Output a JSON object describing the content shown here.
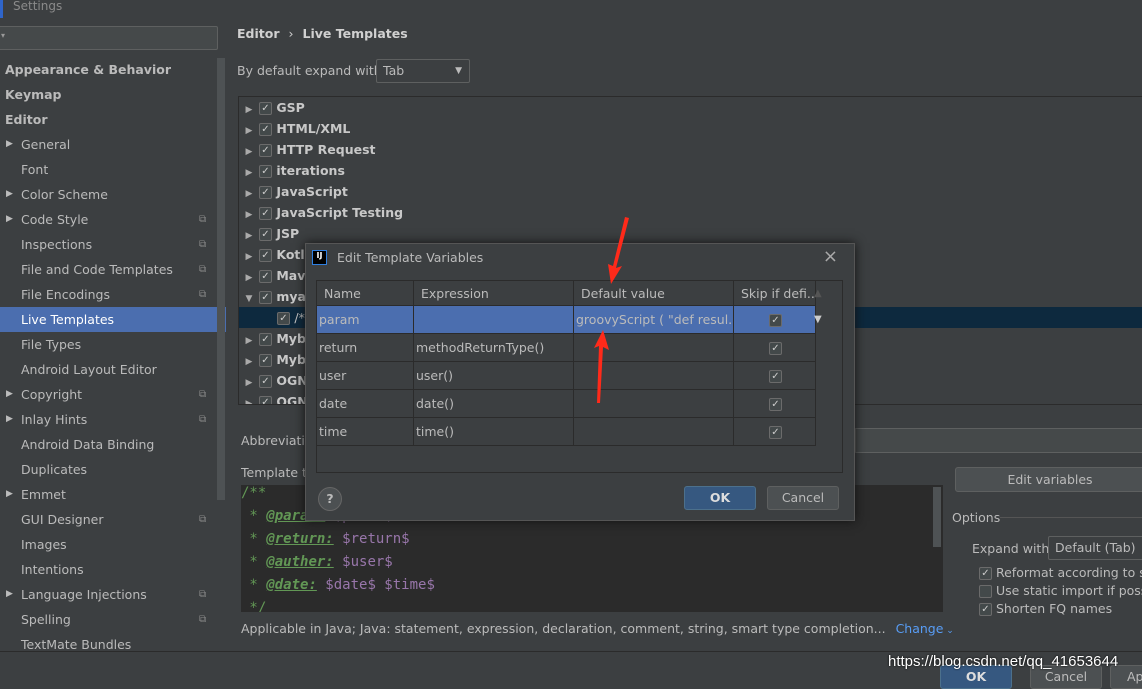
{
  "window": {
    "title": "Settings"
  },
  "sidebar": {
    "items": [
      {
        "label": "Appearance & Behavior",
        "level": 0
      },
      {
        "label": "Keymap",
        "level": 0
      },
      {
        "label": "Editor",
        "level": 0
      },
      {
        "label": "General",
        "level": 1,
        "expandable": true
      },
      {
        "label": "Font",
        "level": 1
      },
      {
        "label": "Color Scheme",
        "level": 1,
        "expandable": true
      },
      {
        "label": "Code Style",
        "level": 1,
        "expandable": true,
        "project": true
      },
      {
        "label": "Inspections",
        "level": 1,
        "project": true
      },
      {
        "label": "File and Code Templates",
        "level": 1,
        "project": true
      },
      {
        "label": "File Encodings",
        "level": 1,
        "project": true
      },
      {
        "label": "Live Templates",
        "level": 1,
        "selected": true
      },
      {
        "label": "File Types",
        "level": 1
      },
      {
        "label": "Android Layout Editor",
        "level": 1
      },
      {
        "label": "Copyright",
        "level": 1,
        "expandable": true,
        "project": true
      },
      {
        "label": "Inlay Hints",
        "level": 1,
        "expandable": true,
        "project": true
      },
      {
        "label": "Android Data Binding",
        "level": 1
      },
      {
        "label": "Duplicates",
        "level": 1
      },
      {
        "label": "Emmet",
        "level": 1,
        "expandable": true
      },
      {
        "label": "GUI Designer",
        "level": 1,
        "project": true
      },
      {
        "label": "Images",
        "level": 1
      },
      {
        "label": "Intentions",
        "level": 1
      },
      {
        "label": "Language Injections",
        "level": 1,
        "expandable": true,
        "project": true
      },
      {
        "label": "Spelling",
        "level": 1,
        "project": true
      },
      {
        "label": "TextMate Bundles",
        "level": 1
      }
    ]
  },
  "breadcrumb": {
    "parent": "Editor",
    "separator": "›",
    "current": "Live Templates"
  },
  "expand": {
    "label": "By default expand with",
    "value": "Tab"
  },
  "tree": {
    "rows": [
      {
        "label": "GSP",
        "expanded": false
      },
      {
        "label": "HTML/XML",
        "expanded": false
      },
      {
        "label": "HTTP Request",
        "expanded": false
      },
      {
        "label": "iterations",
        "expanded": false
      },
      {
        "label": "JavaScript",
        "expanded": false
      },
      {
        "label": "JavaScript Testing",
        "expanded": false
      },
      {
        "label": "JSP",
        "expanded": false
      },
      {
        "label": "Kotl",
        "expanded": false
      },
      {
        "label": "Mav",
        "expanded": false
      },
      {
        "label": "mya",
        "expanded": true
      },
      {
        "label": "/*",
        "child": true,
        "selected": true
      },
      {
        "label": "Myb",
        "expanded": false
      },
      {
        "label": "Myb",
        "expanded": false
      },
      {
        "label": "OGN",
        "expanded": false
      },
      {
        "label": "OGN",
        "expanded": false
      }
    ]
  },
  "abbreviation_label": "Abbreviatio",
  "template_text_label": "Template t",
  "editor": {
    "lines": [
      {
        "prefix": "/**"
      },
      {
        "prefix": " * ",
        "tag": "@param:",
        "vars": " $param$"
      },
      {
        "prefix": " * ",
        "tag": "@return:",
        "vars": " $return$"
      },
      {
        "prefix": " * ",
        "tag": "@auther:",
        "vars": " $user$"
      },
      {
        "prefix": " * ",
        "tag": "@date:",
        "vars": " $date$ $time$"
      },
      {
        "prefix": " */"
      }
    ]
  },
  "edit_variables_button": "Edit variables",
  "options": {
    "title": "Options",
    "expand_label": "Expand with",
    "expand_value": "Default (Tab)",
    "checkboxes": [
      {
        "label": "Reformat according to st",
        "checked": true
      },
      {
        "label": "Use static import if poss",
        "checked": false
      },
      {
        "label": "Shorten FQ names",
        "checked": true
      }
    ]
  },
  "applicable": {
    "text": "Applicable in Java; Java: statement, expression, declaration, comment, string, smart type completion...",
    "change": "Change"
  },
  "footer": {
    "ok": "OK",
    "cancel": "Cancel",
    "apply": "Ap"
  },
  "watermark": "https://blog.csdn.net/qq_41653644",
  "dialog": {
    "title": "Edit Template Variables",
    "logo": "IJ",
    "columns": [
      "Name",
      "Expression",
      "Default value",
      "Skip if defi..."
    ],
    "rows": [
      {
        "name": "param",
        "expression": "",
        "default": "groovyScript ( \"def resul...",
        "skip": true,
        "selected": true
      },
      {
        "name": "return",
        "expression": "methodReturnType()",
        "default": "",
        "skip": true
      },
      {
        "name": "user",
        "expression": "user()",
        "default": "",
        "skip": true
      },
      {
        "name": "date",
        "expression": "date()",
        "default": "",
        "skip": true
      },
      {
        "name": "time",
        "expression": "time()",
        "default": "",
        "skip": true
      }
    ],
    "help": "?",
    "ok": "OK",
    "cancel": "Cancel"
  },
  "colors": {
    "selection": "#4b6eaf",
    "annotation_arrow": "#ff2a1a",
    "link": "#589df6"
  }
}
